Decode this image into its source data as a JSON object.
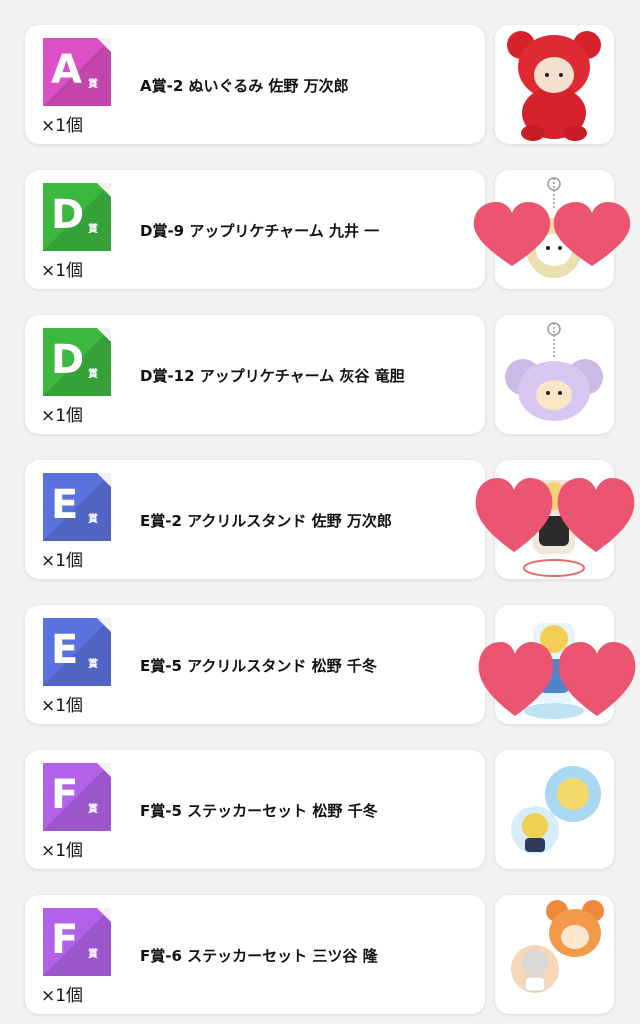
{
  "items": [
    {
      "letter": "A",
      "sho": "賞",
      "color": "#dd4fc4",
      "title": "A賞-2 ぬいぐるみ 佐野 万次郎",
      "qty": "×1個",
      "thumb": "plush-icon",
      "hearts": false
    },
    {
      "letter": "D",
      "sho": "賞",
      "color": "#3cb83f",
      "title": "D賞-9 アップリケチャーム 九井 一",
      "qty": "×1個",
      "thumb": "charm-icon",
      "hearts": true
    },
    {
      "letter": "D",
      "sho": "賞",
      "color": "#3cb83f",
      "title": "D賞-12 アップリケチャーム 灰谷 竜胆",
      "qty": "×1個",
      "thumb": "charm-icon",
      "hearts": false
    },
    {
      "letter": "E",
      "sho": "賞",
      "color": "#5a72de",
      "title": "E賞-2 アクリルスタンド 佐野 万次郎",
      "qty": "×1個",
      "thumb": "acrylic-stand-icon",
      "hearts": true
    },
    {
      "letter": "E",
      "sho": "賞",
      "color": "#5a72de",
      "title": "E賞-5 アクリルスタンド 松野 千冬",
      "qty": "×1個",
      "thumb": "acrylic-stand-icon",
      "hearts": true
    },
    {
      "letter": "F",
      "sho": "賞",
      "color": "#b262e8",
      "title": "F賞-5 ステッカーセット 松野 千冬",
      "qty": "×1個",
      "thumb": "sticker-icon",
      "hearts": false
    },
    {
      "letter": "F",
      "sho": "賞",
      "color": "#b262e8",
      "title": "F賞-6 ステッカーセット 三ツ谷 隆",
      "qty": "×1個",
      "thumb": "sticker-icon",
      "hearts": false
    }
  ],
  "colors": {
    "heart": "#ec5571",
    "background": "#f2f2f2"
  }
}
